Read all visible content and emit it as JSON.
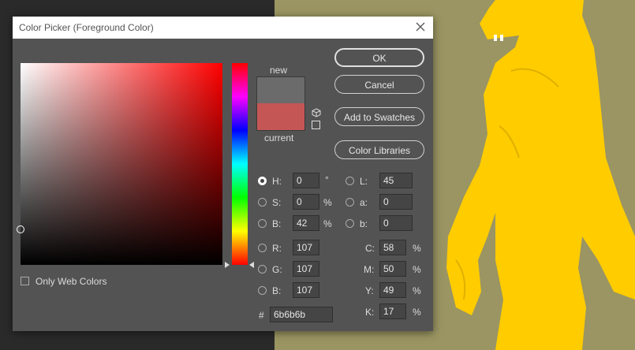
{
  "dialog": {
    "title": "Color Picker (Foreground Color)",
    "close_icon": "close-icon"
  },
  "preview": {
    "new_label": "new",
    "current_label": "current",
    "new_color": "#6b6b6b",
    "current_color": "#c55656"
  },
  "buttons": {
    "ok": "OK",
    "cancel": "Cancel",
    "add_to_swatches": "Add to Swatches",
    "color_libraries": "Color Libraries"
  },
  "hsb": {
    "h_label": "H:",
    "h_value": "0",
    "h_unit": "°",
    "s_label": "S:",
    "s_value": "0",
    "s_unit": "%",
    "b_label": "B:",
    "b_value": "42",
    "b_unit": "%"
  },
  "lab": {
    "l_label": "L:",
    "l_value": "45",
    "a_label": "a:",
    "a_value": "0",
    "b_label": "b:",
    "b_value": "0"
  },
  "rgb": {
    "r_label": "R:",
    "r_value": "107",
    "g_label": "G:",
    "g_value": "107",
    "b_label": "B:",
    "b_value": "107"
  },
  "cmyk": {
    "c_label": "C:",
    "c_value": "58",
    "c_unit": "%",
    "m_label": "M:",
    "m_value": "50",
    "m_unit": "%",
    "y_label": "Y:",
    "y_value": "49",
    "y_unit": "%",
    "k_label": "K:",
    "k_value": "17",
    "k_unit": "%"
  },
  "hex": {
    "label": "#",
    "value": "6b6b6b"
  },
  "options": {
    "only_web_colors": "Only Web Colors"
  },
  "colors": {
    "dialog_bg": "#535353",
    "canvas_left": "#2a2a2a",
    "canvas_right": "#9a9562",
    "artwork": "#ffcc00"
  }
}
